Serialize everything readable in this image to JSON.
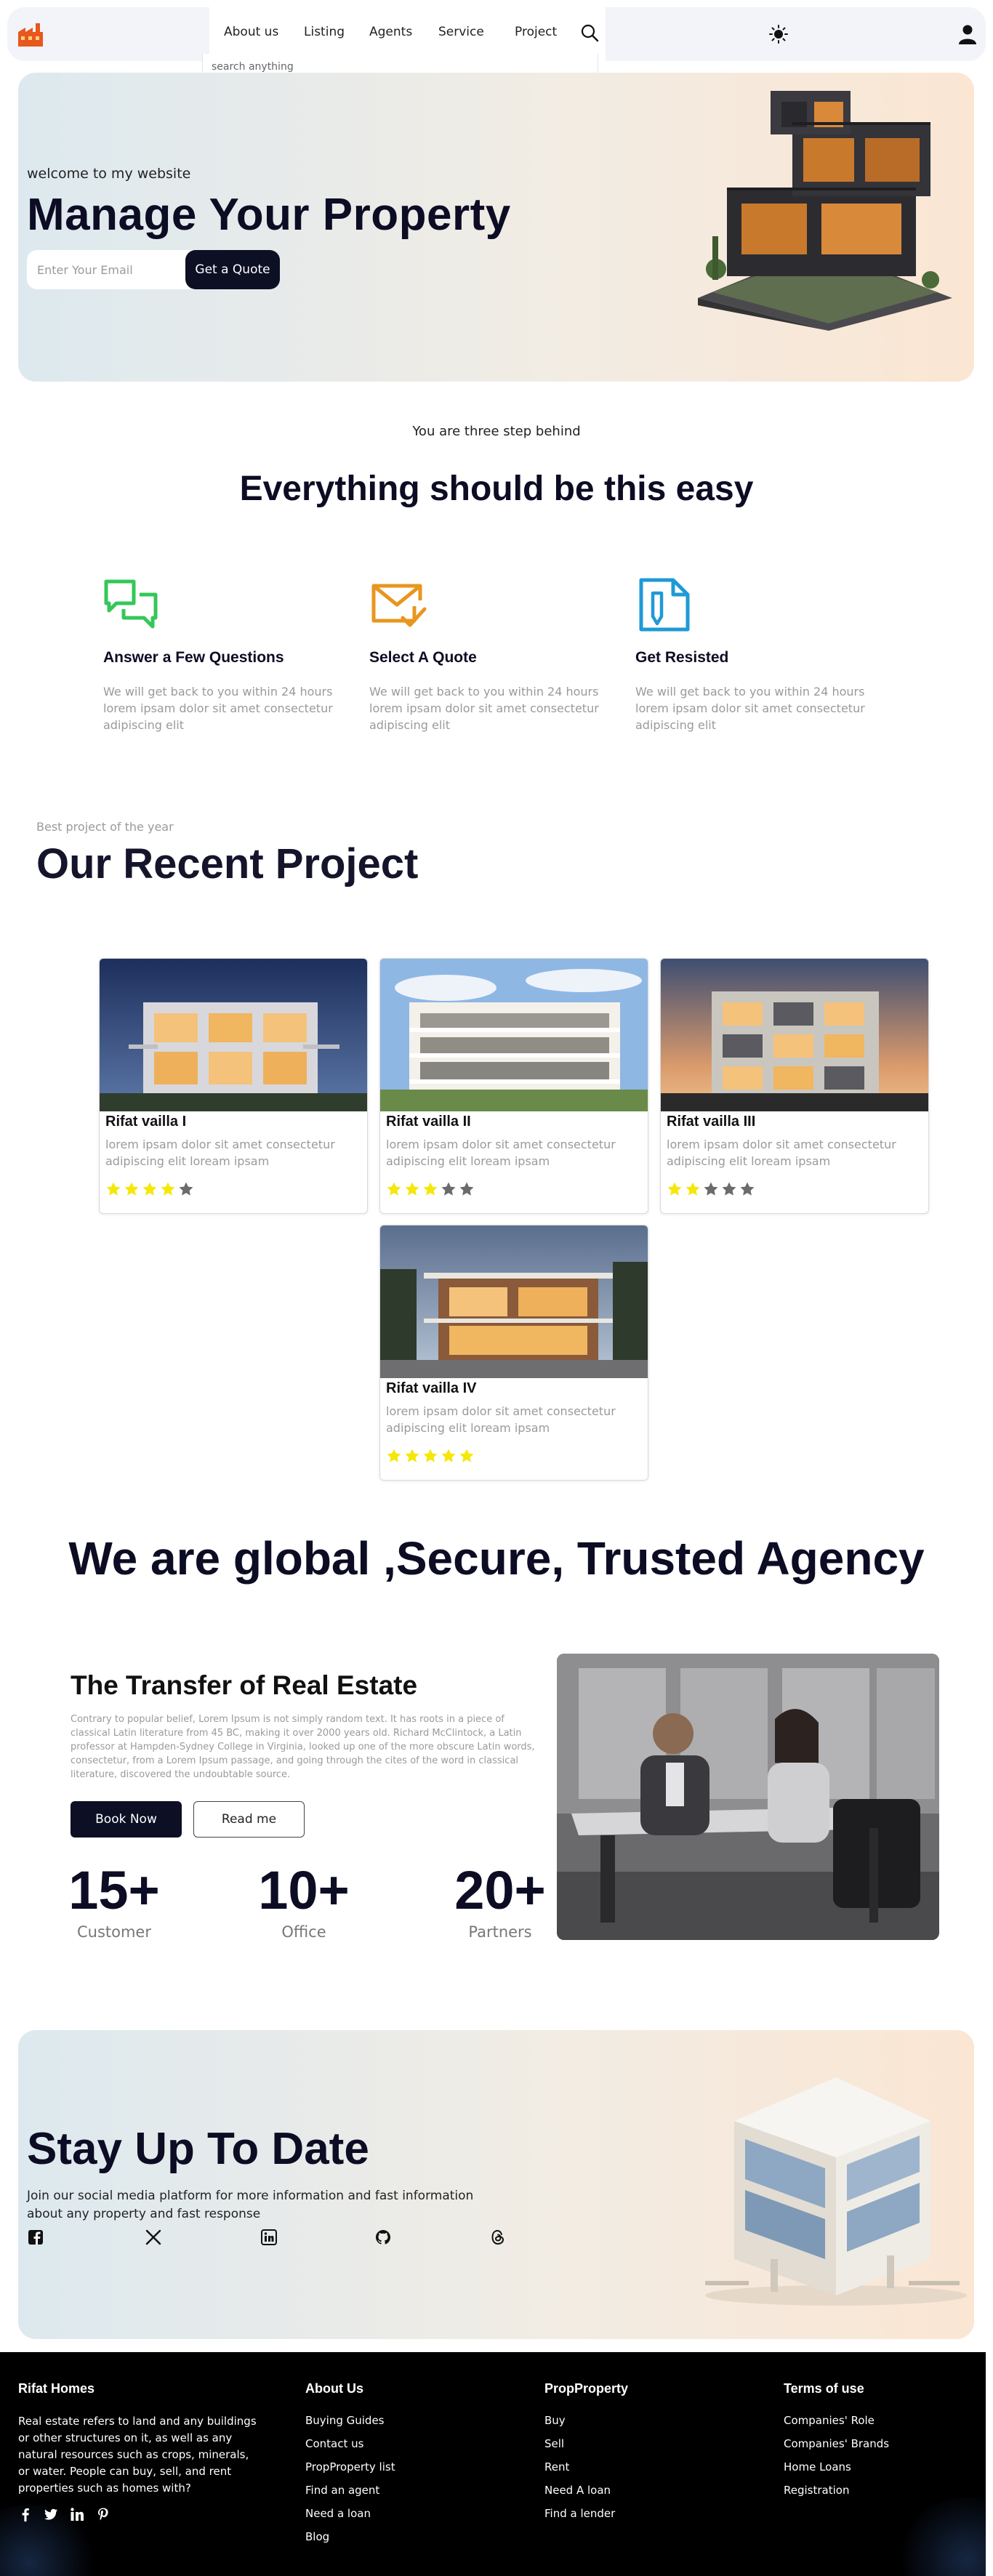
{
  "nav": {
    "links": [
      "About us",
      "Listing",
      "Agents",
      "Service",
      "Project"
    ],
    "search_placeholder": "search anything",
    "icons": [
      "factory-logo-icon",
      "search-icon",
      "sun-icon",
      "user-icon"
    ]
  },
  "hero": {
    "welcome": "welcome to my website",
    "title": "Manage Your Property",
    "email_placeholder": "Enter Your Email",
    "quote_button": "Get a Quote"
  },
  "steps": {
    "subtitle": "You are three step behind",
    "title": "Everything should be this easy",
    "items": [
      {
        "title": "Answer a Few Questions",
        "desc": "We will get back to you within 24 hours lorem ipsam dolor sit amet consectetur adipiscing elit",
        "icon": "chat-icon",
        "color": "#34c759"
      },
      {
        "title": "Select A Quote",
        "desc": "We will get back to you within 24 hours lorem ipsam dolor sit amet consectetur adipiscing elit",
        "icon": "mail-check-icon",
        "color": "#e8961d"
      },
      {
        "title": "Get Resisted",
        "desc": "We will get back to you within 24 hours lorem ipsam dolor sit amet consectetur adipiscing elit",
        "icon": "document-pen-icon",
        "color": "#1f9ad6"
      }
    ]
  },
  "projects": {
    "subtitle": "Best project of the year",
    "title": "Our Recent Project",
    "cards": [
      {
        "name": "Rifat vailla I",
        "desc": "lorem ipsam dolor sit amet consectetur adipiscing elit loream ipsam",
        "rating": 4
      },
      {
        "name": "Rifat vailla II",
        "desc": "lorem ipsam dolor sit amet consectetur adipiscing elit loream ipsam",
        "rating": 3
      },
      {
        "name": "Rifat vailla III",
        "desc": "lorem ipsam dolor sit amet consectetur adipiscing elit loream ipsam",
        "rating": 2
      },
      {
        "name": "Rifat vailla IV",
        "desc": "lorem ipsam dolor sit amet consectetur adipiscing elit loream ipsam",
        "rating": 5
      }
    ],
    "star_max": 5,
    "star_on_color": "#f5e70a",
    "star_off_color": "#6b6b6b"
  },
  "agency": {
    "title": "We are global ,Secure, Trusted Agency",
    "transfer_title": "The Transfer of Real Estate",
    "transfer_desc": "Contrary to popular belief, Lorem Ipsum is not simply random text. It has roots in a piece of classical Latin literature from 45 BC, making it over 2000 years old. Richard McClintock, a Latin professor at Hampden-Sydney College in Virginia, looked up one of the more obscure Latin words, consectetur, from a Lorem Ipsum passage, and going through the cites of the word in classical literature, discovered the undoubtable source.",
    "book_button": "Book Now",
    "read_button": "Read me",
    "stats": [
      {
        "value": "15+",
        "label": "Customer"
      },
      {
        "value": "10+",
        "label": "Office"
      },
      {
        "value": "20+",
        "label": "Partners"
      }
    ]
  },
  "stay": {
    "title": "Stay Up To Date",
    "desc": "Join our social media platform for more information and fast information about any property and fast response",
    "social_icons": [
      "facebook-icon",
      "x-icon",
      "linkedin-icon",
      "github-icon",
      "threads-icon"
    ]
  },
  "footer": {
    "brand": {
      "title": "Rifat Homes",
      "desc": "Real estate refers to land and any buildings or other structures on it, as well as any natural resources such as crops, minerals, or water. People can buy, sell, and rent properties such as homes with?",
      "social": [
        "facebook-icon",
        "twitter-icon",
        "linkedin-icon",
        "pinterest-icon"
      ]
    },
    "columns": [
      {
        "title": "About Us",
        "items": [
          "Buying Guides",
          "Contact us",
          "PropProperty list",
          "Find an agent",
          "Need a loan",
          "Blog"
        ]
      },
      {
        "title": "PropProperty",
        "items": [
          "Buy",
          "Sell",
          "Rent",
          "Need A loan",
          "Find a lender"
        ]
      },
      {
        "title": "Terms of use",
        "items": [
          "Companies' Role",
          "Companies' Brands",
          "Home Loans",
          "Registration"
        ]
      }
    ]
  },
  "colors": {
    "navy": "#0d0f24",
    "gradient_start": "#dde9ef",
    "gradient_end": "#fbe6d3",
    "muted_text": "#9a9a9a"
  }
}
